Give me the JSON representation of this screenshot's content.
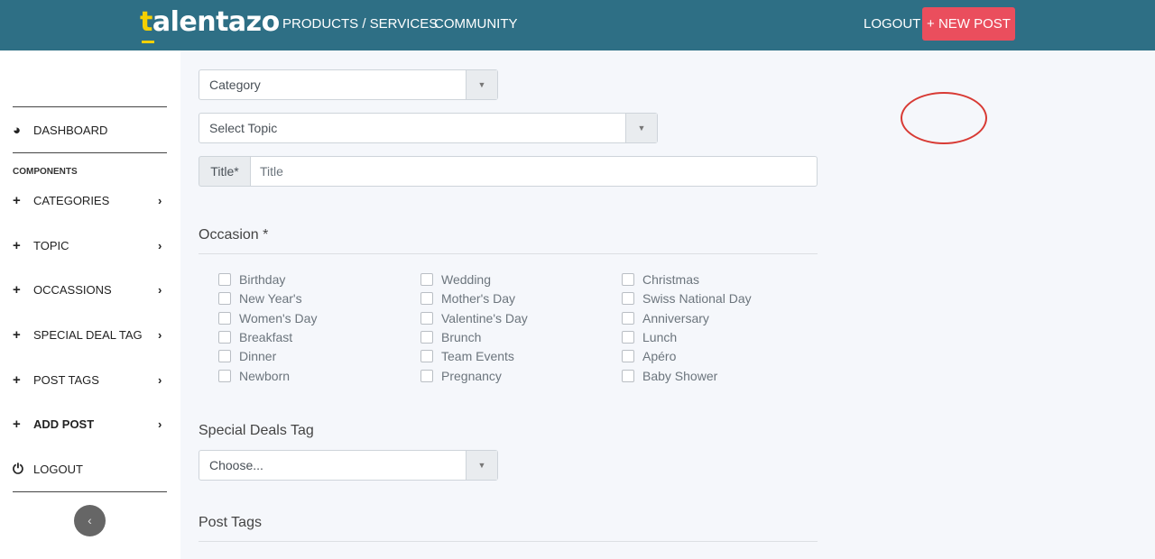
{
  "navbar": {
    "brand_first": "t",
    "brand_rest": "alentazo",
    "products": "PRODUCTS / SERVICES",
    "community": "COMMUNITY",
    "logout": "LOGOUT",
    "new_post": "+ NEW POST",
    "accent_color": "#2e6f85",
    "button_color": "#ea4e5d"
  },
  "sidebar": {
    "dashboard": {
      "icon": "dashboard-icon",
      "glyph": "◕",
      "label": "DASHBOARD"
    },
    "heading": "COMPONENTS",
    "items": [
      {
        "label": "CATEGORIES",
        "icon": "plus-icon",
        "glyph": "+",
        "chev": "›"
      },
      {
        "label": "TOPIC",
        "icon": "plus-icon",
        "glyph": "+",
        "chev": "›"
      },
      {
        "label": "OCCASSIONS",
        "icon": "plus-icon",
        "glyph": "+",
        "chev": "›"
      },
      {
        "label": "SPECIAL DEAL TAG",
        "icon": "plus-icon",
        "glyph": "+",
        "chev": "›"
      },
      {
        "label": "POST TAGS",
        "icon": "plus-icon",
        "glyph": "+",
        "chev": "›"
      },
      {
        "label": "ADD POST",
        "icon": "plus-icon",
        "glyph": "+",
        "chev": "›",
        "active": true
      }
    ],
    "logout": {
      "icon": "power-icon",
      "glyph": "⏻",
      "label": "LOGOUT"
    },
    "collapse_glyph": "‹"
  },
  "form": {
    "category": {
      "value": "Category",
      "arrow": "▼"
    },
    "topic": {
      "value": "Select Topic",
      "arrow": "▼"
    },
    "title_label": "Title*",
    "title_placeholder": "Title",
    "occasion_heading": "Occasion *",
    "occasions": [
      [
        "Birthday",
        "New Year's",
        "Women's Day",
        "Breakfast",
        "Dinner",
        "Newborn"
      ],
      [
        "Wedding",
        "Mother's Day",
        "Valentine's Day",
        "Brunch",
        "Team Events",
        "Pregnancy"
      ],
      [
        "Christmas",
        "Swiss National Day",
        "Anniversary",
        "Lunch",
        "Apéro",
        "Baby Shower"
      ]
    ],
    "special_deals_heading": "Special Deals Tag",
    "special_deals": {
      "value": "Choose...",
      "arrow": "▼"
    },
    "post_tags_heading": "Post Tags"
  }
}
